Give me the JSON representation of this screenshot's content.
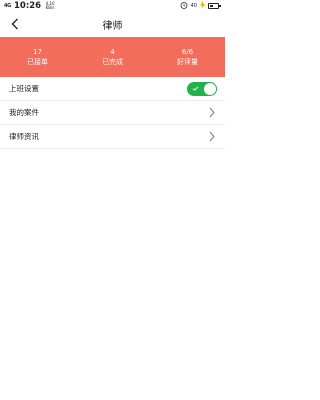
{
  "status_bar": {
    "signal": "4G",
    "time": "10:26",
    "net_speed": "4.10 KB/s",
    "alarm_icon": "alarm-icon",
    "battery_pct": "40",
    "battery_fill": 0.4
  },
  "nav": {
    "back_icon": "back-arrow-icon",
    "title": "律师"
  },
  "stats": [
    {
      "value": "17",
      "label": "已接单"
    },
    {
      "value": "4",
      "label": "已完成"
    },
    {
      "value": "6/6",
      "label": "好评量"
    }
  ],
  "menu": {
    "on_duty": {
      "label": "上班设置",
      "enabled": true
    },
    "my_cases": {
      "label": "我的案件"
    },
    "lawyer_news": {
      "label": "律师资讯"
    }
  },
  "colors": {
    "banner": "#f26d5b",
    "toggle_on": "#22b14c"
  }
}
